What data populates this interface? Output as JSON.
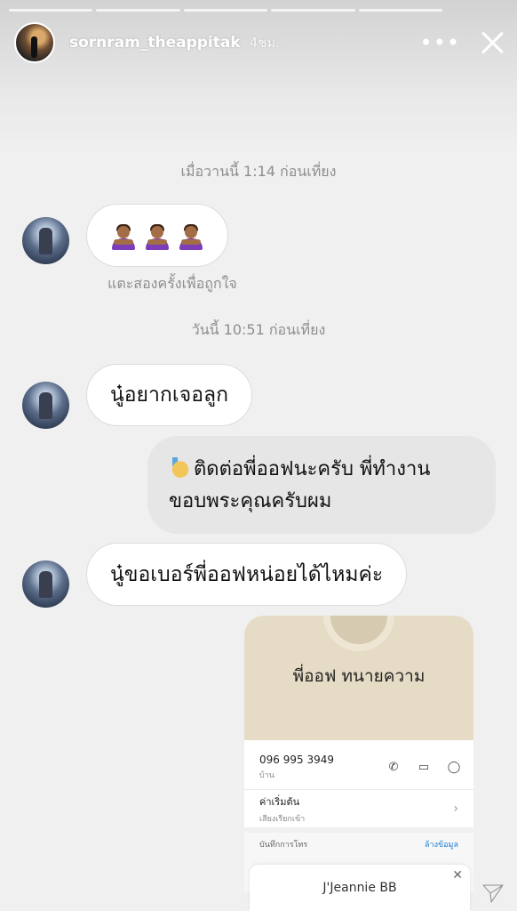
{
  "story": {
    "username": "sornram_theappitak",
    "posted_ago": "4ชม.",
    "more_icon": "more-horizontal-icon",
    "close_icon": "close-icon",
    "segments": 5
  },
  "chat": {
    "timestamp_1": "เมื่อวานนี้ 1:14 ก่อนเที่ยง",
    "like_hint": "แตะสองครั้งเพื่อถูกใจ",
    "timestamp_2": "วันนี้ 10:51 ก่อนเที่ยง",
    "msg_1": "นู๋อยากเจอลูก",
    "reply_line_1": "ติดต่อพี่ออฟนะครับ พี่ทำงาน",
    "reply_line_2": "ขอบพระคุณครับผม",
    "msg_2": "นู๋ขอเบอร์พี่ออฟหน่อยได้ไหมค่ะ"
  },
  "contact_card": {
    "name": "พี่ออฟ ทนายความ",
    "phone": "096 995 3949",
    "phone_type": "บ้าน",
    "ringtone_title": "ค่าเริ่มต้น",
    "ringtone_sub": "เสียงเรียกเข้า",
    "call_log_label": "บันทึกการโทร",
    "clear_label": "ล้างข้อมูล"
  },
  "overlay": {
    "name": "J'Jeannie BB"
  }
}
